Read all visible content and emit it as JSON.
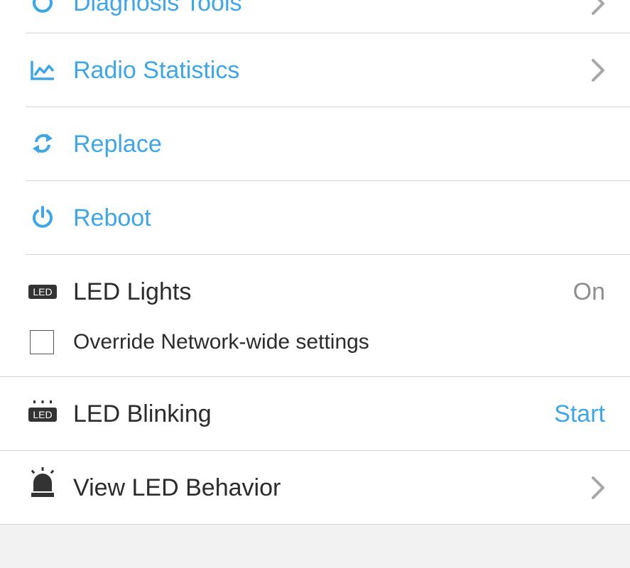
{
  "menu": {
    "diagnosis": {
      "label": "Diagnosis Tools",
      "icon": "diagnosis-icon"
    },
    "radio_stats": {
      "label": "Radio Statistics",
      "icon": "line-chart-icon"
    },
    "replace": {
      "label": "Replace",
      "icon": "replace-icon"
    },
    "reboot": {
      "label": "Reboot",
      "icon": "power-icon"
    },
    "led_lights": {
      "label": "LED Lights",
      "value": "On",
      "icon_text": "LED"
    },
    "override": {
      "label": "Override Network-wide settings",
      "checked": false
    },
    "led_blinking": {
      "label": "LED Blinking",
      "action": "Start",
      "icon_text": "LED"
    },
    "led_behavior": {
      "label": "View LED Behavior",
      "icon": "siren-icon"
    }
  },
  "colors": {
    "accent": "#3ea6e6",
    "text": "#2b2b2b",
    "secondary": "#8e8e8e",
    "chevron": "#a7a7a7"
  }
}
